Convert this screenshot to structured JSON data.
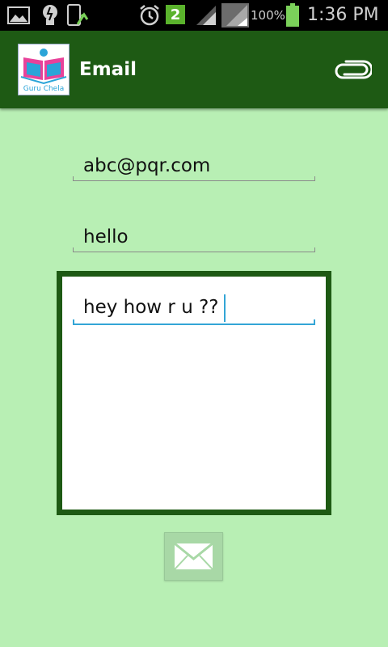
{
  "status_bar": {
    "notification_badge": "2",
    "battery": "100%",
    "time": "1:36 PM",
    "icons": [
      "gallery-icon",
      "lightbulb-icon",
      "phone-upload-icon",
      "alarm-icon",
      "notification-badge-icon",
      "signal-icon",
      "wifi-icon",
      "battery-icon"
    ]
  },
  "action_bar": {
    "logo_text": "Guru Chela",
    "title": "Email",
    "attach_icon": "paperclip-icon"
  },
  "form": {
    "to_value": "abc@pqr.com",
    "subject_value": "hello",
    "body_value": "hey how r u ??"
  },
  "send_button": {
    "icon": "envelope-icon"
  },
  "colors": {
    "action_bar": "#1e5a14",
    "background": "#b8efb4",
    "focus_accent": "#33a5d6"
  }
}
